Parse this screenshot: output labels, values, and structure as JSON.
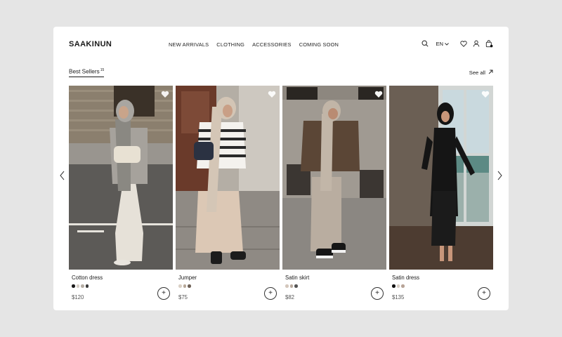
{
  "brand": "SAAKINUN",
  "nav": [
    {
      "label": "NEW ARRIVALS"
    },
    {
      "label": "CLOTHING"
    },
    {
      "label": "ACCESSORIES"
    },
    {
      "label": "COMING SOON"
    }
  ],
  "header": {
    "language": "EN",
    "icons": [
      "search-icon",
      "chevron-down-icon",
      "heart-icon",
      "user-icon",
      "bag-icon"
    ]
  },
  "section": {
    "title": "Best Sellers",
    "count": "15",
    "see_all": "See all"
  },
  "products": [
    {
      "name": "Cotton dress",
      "price": "$120",
      "swatches": [
        "#1a1a1a",
        "#d6cfc6",
        "#b5ada4",
        "#3a3a3a"
      ]
    },
    {
      "name": "Jumper",
      "price": "$75",
      "swatches": [
        "#d9cfc4",
        "#b8a99a",
        "#6e6157"
      ]
    },
    {
      "name": "Satin skirt",
      "price": "$82",
      "swatches": [
        "#d4c7bc",
        "#b9aa9d",
        "#555555"
      ]
    },
    {
      "name": "Satin dress",
      "price": "$135",
      "swatches": [
        "#111111",
        "#d8cfc5",
        "#b8a497"
      ]
    }
  ],
  "colors": {
    "page_bg": "#e5e5e5",
    "card_bg": "#ffffff",
    "text": "#1a1a1a"
  }
}
